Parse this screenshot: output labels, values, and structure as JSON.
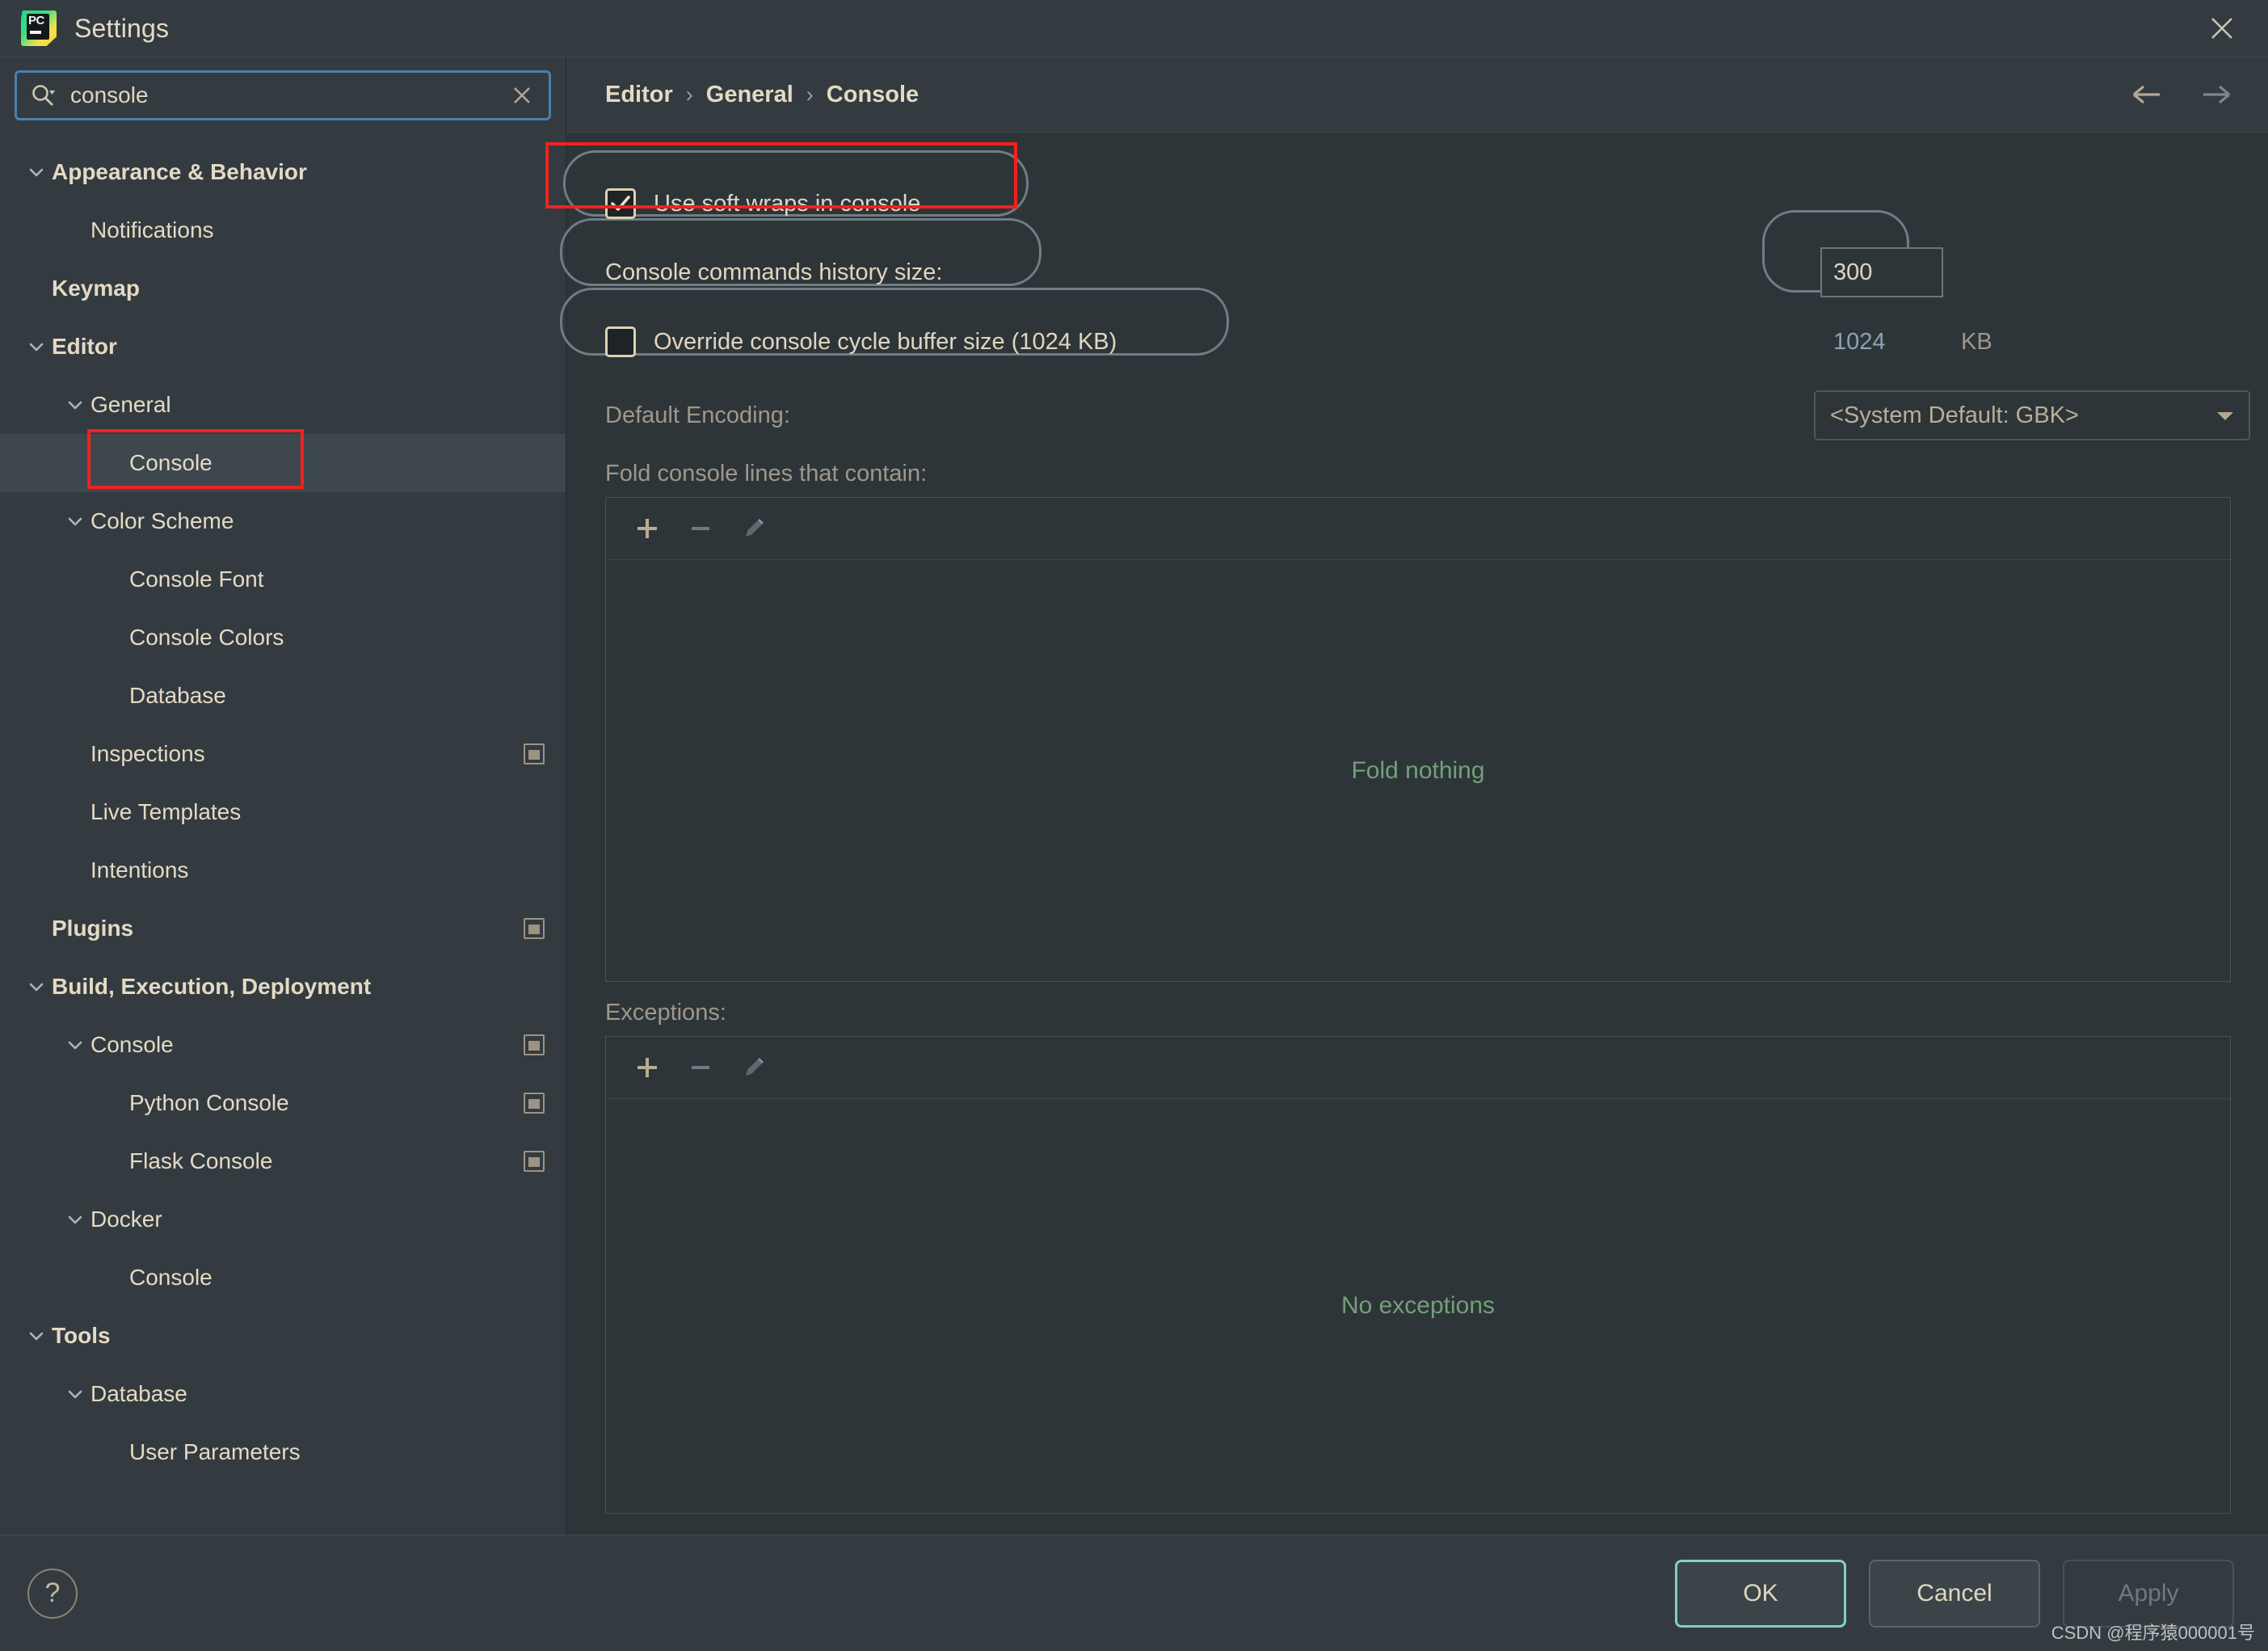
{
  "window": {
    "title": "Settings",
    "logo_text": "PC",
    "close_icon": "close-icon"
  },
  "search": {
    "value": "console",
    "placeholder": "",
    "icon": "search-icon",
    "clear_icon": "close-icon"
  },
  "sidebar": {
    "items": [
      {
        "label": "Appearance & Behavior",
        "depth": 0,
        "bold": true,
        "chevron": "chevron-down",
        "badge": false,
        "selected": false,
        "highlight": false
      },
      {
        "label": "Notifications",
        "depth": 1,
        "bold": false,
        "chevron": "none",
        "badge": false,
        "selected": false,
        "highlight": false
      },
      {
        "label": "Keymap",
        "depth": 0,
        "bold": true,
        "chevron": "none",
        "badge": false,
        "selected": false,
        "highlight": false
      },
      {
        "label": "Editor",
        "depth": 0,
        "bold": true,
        "chevron": "chevron-down",
        "badge": false,
        "selected": false,
        "highlight": false
      },
      {
        "label": "General",
        "depth": 1,
        "bold": false,
        "chevron": "chevron-down",
        "badge": false,
        "selected": false,
        "highlight": false
      },
      {
        "label": "Console",
        "depth": 2,
        "bold": false,
        "chevron": "none",
        "badge": false,
        "selected": true,
        "highlight": true
      },
      {
        "label": "Color Scheme",
        "depth": 1,
        "bold": false,
        "chevron": "chevron-down",
        "badge": false,
        "selected": false,
        "highlight": false
      },
      {
        "label": "Console Font",
        "depth": 2,
        "bold": false,
        "chevron": "none",
        "badge": false,
        "selected": false,
        "highlight": false
      },
      {
        "label": "Console Colors",
        "depth": 2,
        "bold": false,
        "chevron": "none",
        "badge": false,
        "selected": false,
        "highlight": false
      },
      {
        "label": "Database",
        "depth": 2,
        "bold": false,
        "chevron": "none",
        "badge": false,
        "selected": false,
        "highlight": false
      },
      {
        "label": "Inspections",
        "depth": 1,
        "bold": false,
        "chevron": "none",
        "badge": true,
        "selected": false,
        "highlight": false
      },
      {
        "label": "Live Templates",
        "depth": 1,
        "bold": false,
        "chevron": "none",
        "badge": false,
        "selected": false,
        "highlight": false
      },
      {
        "label": "Intentions",
        "depth": 1,
        "bold": false,
        "chevron": "none",
        "badge": false,
        "selected": false,
        "highlight": false
      },
      {
        "label": "Plugins",
        "depth": 0,
        "bold": true,
        "chevron": "none",
        "badge": true,
        "selected": false,
        "highlight": false
      },
      {
        "label": "Build, Execution, Deployment",
        "depth": 0,
        "bold": true,
        "chevron": "chevron-down",
        "badge": false,
        "selected": false,
        "highlight": false
      },
      {
        "label": "Console",
        "depth": 1,
        "bold": false,
        "chevron": "chevron-down",
        "badge": true,
        "selected": false,
        "highlight": false
      },
      {
        "label": "Python Console",
        "depth": 2,
        "bold": false,
        "chevron": "none",
        "badge": true,
        "selected": false,
        "highlight": false
      },
      {
        "label": "Flask Console",
        "depth": 2,
        "bold": false,
        "chevron": "none",
        "badge": true,
        "selected": false,
        "highlight": false
      },
      {
        "label": "Docker",
        "depth": 1,
        "bold": false,
        "chevron": "chevron-down",
        "badge": false,
        "selected": false,
        "highlight": false
      },
      {
        "label": "Console",
        "depth": 2,
        "bold": false,
        "chevron": "none",
        "badge": false,
        "selected": false,
        "highlight": false
      },
      {
        "label": "Tools",
        "depth": 0,
        "bold": true,
        "chevron": "chevron-down",
        "badge": false,
        "selected": false,
        "highlight": false
      },
      {
        "label": "Database",
        "depth": 1,
        "bold": false,
        "chevron": "chevron-down",
        "badge": false,
        "selected": false,
        "highlight": false
      },
      {
        "label": "User Parameters",
        "depth": 2,
        "bold": false,
        "chevron": "none",
        "badge": false,
        "selected": false,
        "highlight": false
      }
    ]
  },
  "breadcrumb": {
    "items": [
      "Editor",
      "General",
      "Console"
    ],
    "separator": "›",
    "back_icon": "arrow-left-icon",
    "forward_icon": "arrow-right-icon"
  },
  "settings": {
    "soft_wraps": {
      "label": "Use soft wraps in console",
      "checked": true
    },
    "history_size": {
      "label": "Console commands history size:",
      "value": "300"
    },
    "override_buffer": {
      "label": "Override console cycle buffer size (1024 KB)",
      "checked": false,
      "value": "1024",
      "unit": "KB"
    },
    "default_encoding": {
      "label": "Default Encoding:",
      "value": "<System Default: GBK>"
    },
    "fold_lines": {
      "label": "Fold console lines that contain:",
      "empty_text": "Fold nothing",
      "toolbar": {
        "add": "plus-icon",
        "remove": "minus-icon",
        "edit": "pencil-icon"
      }
    },
    "exceptions": {
      "label": "Exceptions:",
      "empty_text": "No exceptions",
      "toolbar": {
        "add": "plus-icon",
        "remove": "minus-icon",
        "edit": "pencil-icon"
      }
    }
  },
  "footer": {
    "help_label": "?",
    "ok_label": "OK",
    "cancel_label": "Cancel",
    "apply_label": "Apply",
    "apply_disabled": true
  },
  "watermark": {
    "text": "CSDN @程序猿000001号"
  },
  "colors": {
    "accent_focus": "#4b7fae",
    "annotation_red": "#f4201f",
    "ok_focus": "#82cfc7",
    "empty_green": "#72a078",
    "text": "#e0d6c0"
  }
}
